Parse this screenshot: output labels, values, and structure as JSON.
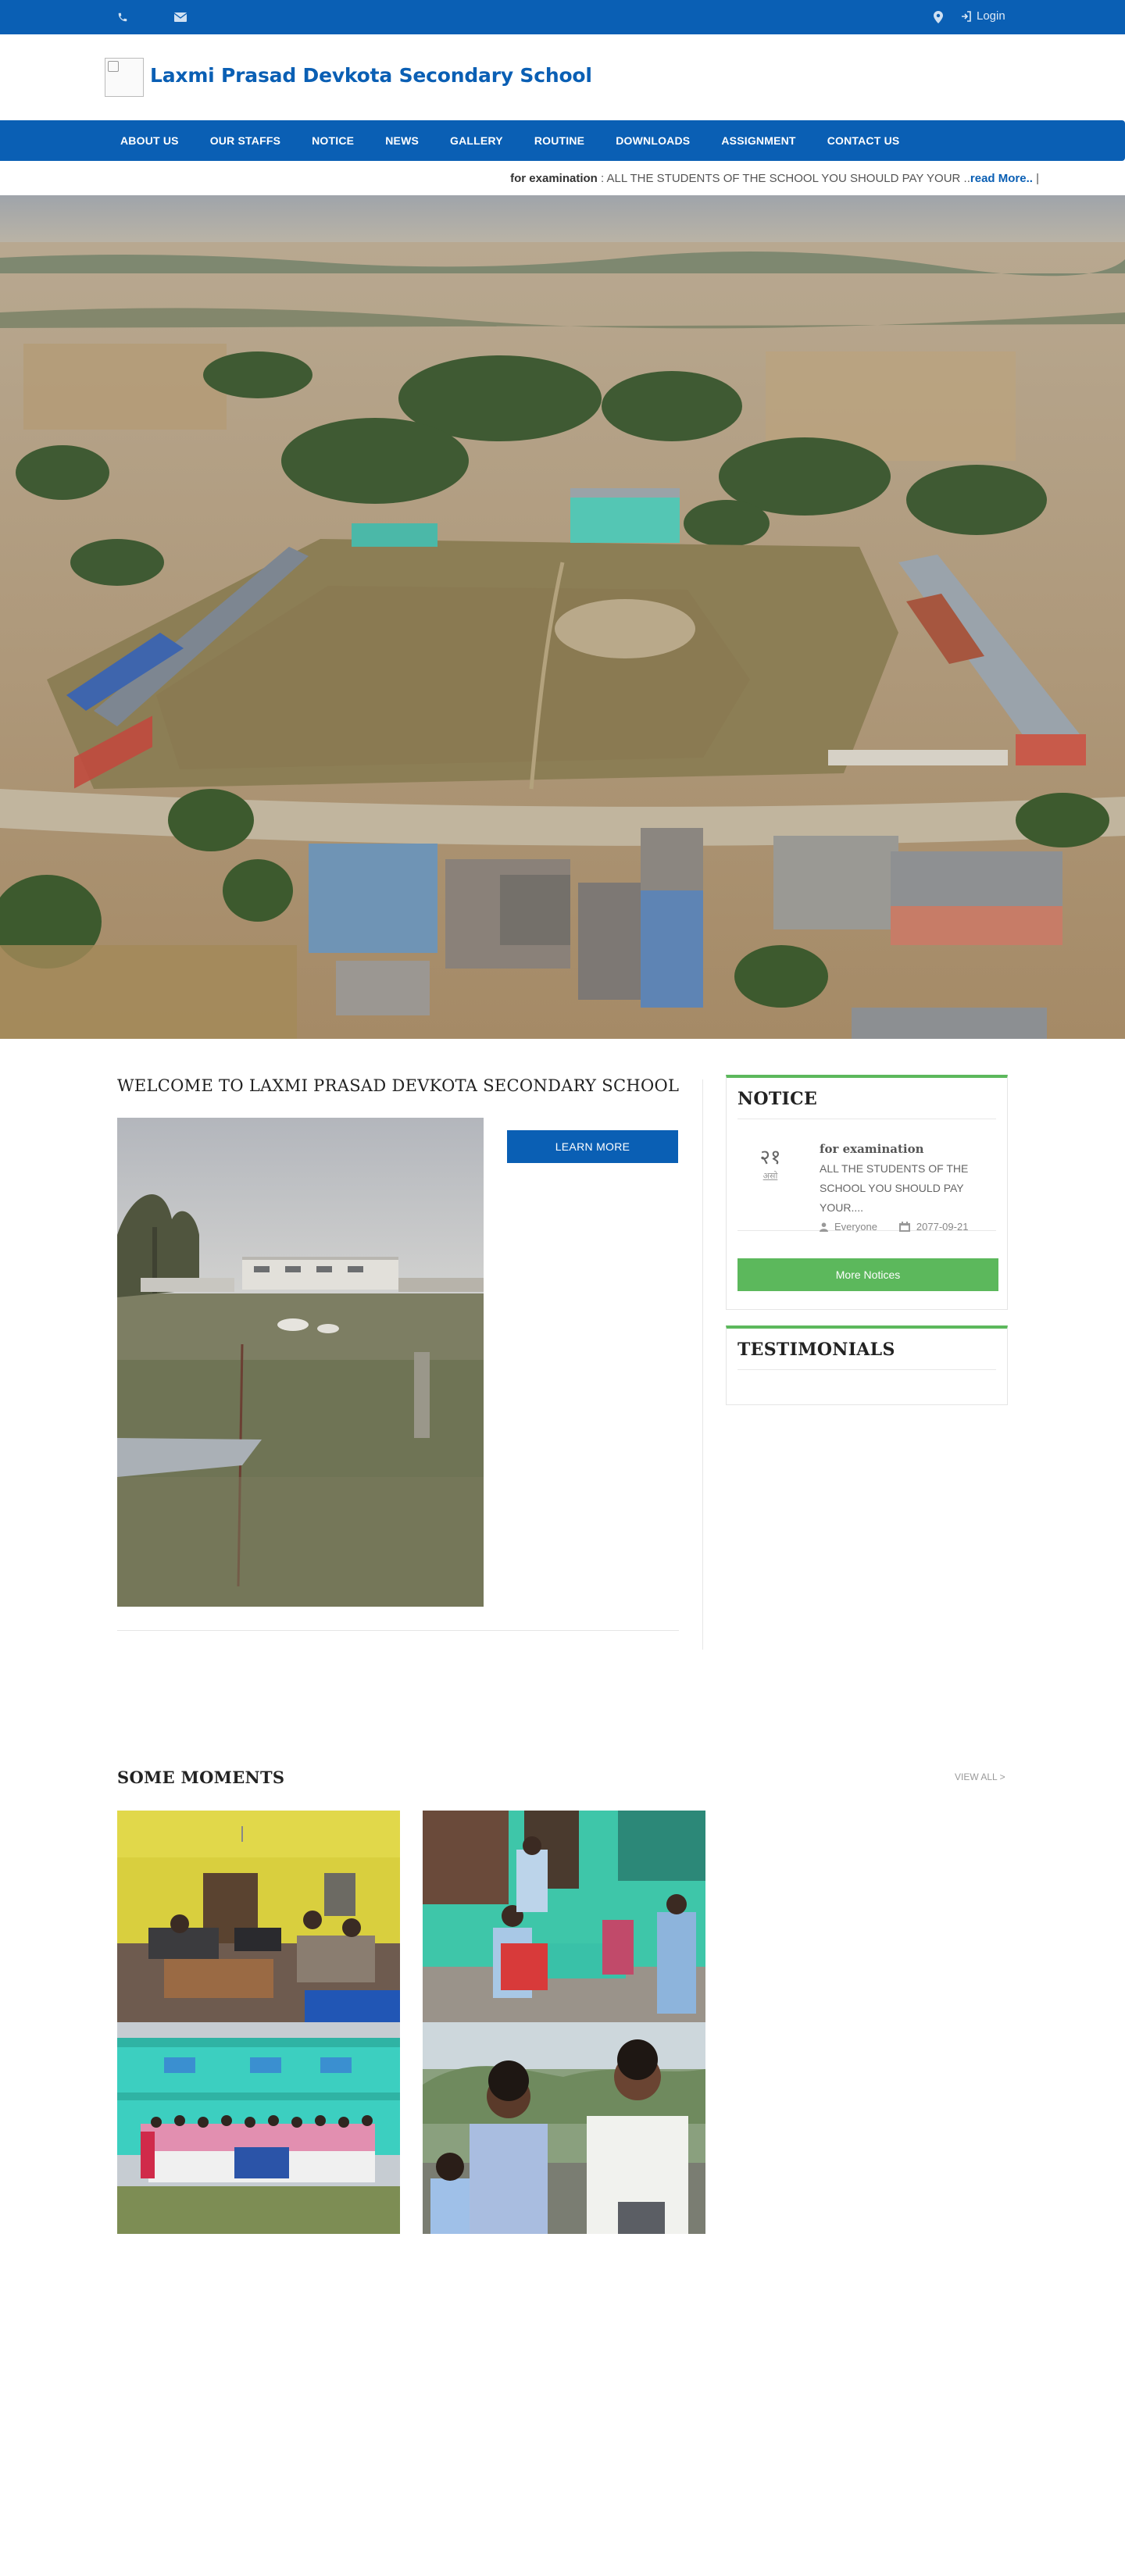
{
  "site": {
    "title": "Laxmi Prasad Devkota Secondary School"
  },
  "topbar": {
    "phone_icon": "phone-icon",
    "email_icon": "envelope-icon",
    "map_icon": "map-marker-icon",
    "login_label": "Login"
  },
  "nav": {
    "items": [
      "ABOUT US",
      "OUR STAFFS",
      "NOTICE",
      "NEWS",
      "GALLERY",
      "ROUTINE",
      "DOWNLOADS",
      "ASSIGNMENT",
      "CONTACT US"
    ]
  },
  "ticker": {
    "title": "for examination",
    "text": " : ALL THE STUDENTS OF THE SCHOOL YOU SHOULD PAY YOUR ..",
    "link": "read More..",
    "sep": " |"
  },
  "welcome": {
    "title": "WELCOME TO LAXMI PRASAD DEVKOTA SECONDARY SCHOOL",
    "learn_more": "LEARN MORE"
  },
  "notice": {
    "heading": "NOTICE",
    "items": [
      {
        "day": "२१",
        "month": "असो",
        "title": "for examination",
        "text": "ALL THE STUDENTS OF THE SCHOOL YOU SHOULD PAY YOUR....",
        "audience": "Everyone",
        "date": "2077-09-21"
      }
    ],
    "more_label": "More Notices"
  },
  "testimonials": {
    "heading": "TESTIMONIALS"
  },
  "moments": {
    "heading": "SOME MOMENTS",
    "view_all": "VIEW ALL >"
  },
  "colors": {
    "primary": "#0a5fb4",
    "accent_green": "#5cb85c"
  }
}
